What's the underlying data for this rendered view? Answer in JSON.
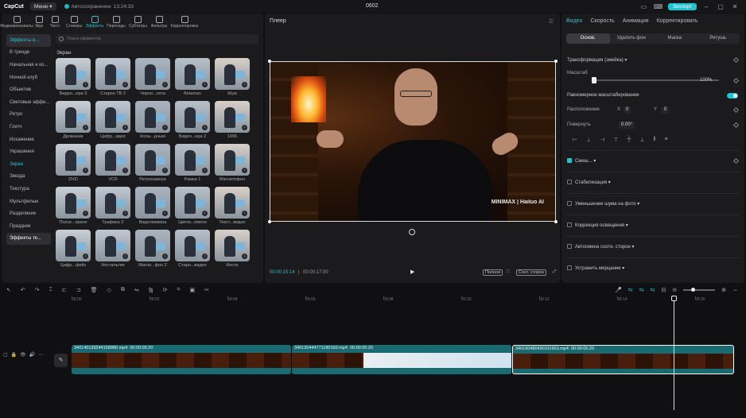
{
  "titlebar": {
    "logo": "CapCut",
    "menu": "Меню",
    "autosave": "Автосохранение: 13:24:33",
    "project": "0602",
    "export": "Экспорт"
  },
  "toolbar": [
    "Медиаматериалы",
    "Звук",
    "Текст",
    "Стикеры",
    "Эффекты",
    "Переходы",
    "Субтитры",
    "Фильтры",
    "Корректировка"
  ],
  "categories": [
    "Эффекты в...",
    "В тренде",
    "Начальная и ко...",
    "Ночной клуб",
    "Объектив",
    "Световые эффе...",
    "Ретро",
    "Глитч",
    "Искажение",
    "Украшения",
    "Экран",
    "Звезда",
    "Текстура",
    "Мультфильм",
    "Разделение",
    "Праздник",
    "Эффекты те..."
  ],
  "search_placeholder": "Поиск эффектов",
  "section_title": "Экран",
  "effects": [
    "Видео...ера 3",
    "Старое ТВ 2",
    "Черно...сета",
    "Betamax",
    "Шум",
    "Дрожание",
    "Цифр...идео",
    "Колы...рным",
    "Видео...ера 2",
    "1995",
    "DVD",
    "VCR",
    "Ретрокамера",
    "Рамка 1",
    "Магнитофон",
    "Полос...кране",
    "Графика 3",
    "Видеокамера",
    "Цвети...омехи",
    "Текст...видео",
    "Цифр...фейс",
    "Ностальгия",
    "Магни...фон 2",
    "Старо...видео",
    "Инста"
  ],
  "player": {
    "title": "Плеер",
    "current": "00:00:15:14",
    "total": "00:00:17:00",
    "full": "Полное",
    "ratio": "Соот. сторон",
    "watermark": "MINIMAX | Hailuo AI"
  },
  "props": {
    "tabs": [
      "Видео",
      "Скорость",
      "Анимация",
      "Корректировать"
    ],
    "subtabs": [
      "Основ.",
      "Удалить фон",
      "Маска",
      "Ретушь"
    ],
    "transform": "Трансформация (змейка)",
    "scale_label": "Масштаб",
    "scale_value": "100%",
    "uniform": "Равномерное масштабирование",
    "position": "Расположение",
    "pos_x": "0",
    "pos_y": "0",
    "rotate": "Повернуть",
    "rotate_value": "0.00°",
    "blend": "Смеш...",
    "stabilize": "Стабилизация",
    "denoise": "Уменьшение шума на фото",
    "light": "Коррекция освещения",
    "autoratio": "Автосмена соотн. сторон",
    "flicker": "Устранить мерцание"
  },
  "ruler": [
    "00:00",
    "00:02",
    "00:04",
    "00:06",
    "00:08",
    "00:10",
    "00:12",
    "00:14",
    "00:16"
  ],
  "clips": [
    {
      "name": "340140139244158980.mp4",
      "dur": "00:00:05:20"
    },
    {
      "name": "340120444771180160.mp4",
      "dur": "00:00:05:20"
    },
    {
      "name": "340160480490311663.mp4",
      "dur": "00:00:05:20"
    }
  ],
  "track": {
    "cover": "Обложка"
  }
}
